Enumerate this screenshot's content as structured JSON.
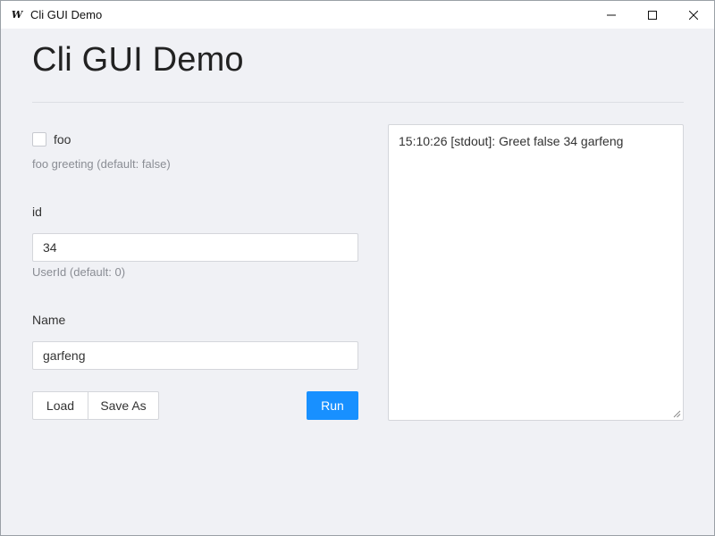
{
  "window": {
    "title": "Cli GUI Demo",
    "app_icon": "W",
    "controls": [
      "minimize-icon",
      "maximize-icon",
      "close-icon"
    ]
  },
  "page": {
    "title": "Cli GUI Demo"
  },
  "form": {
    "foo": {
      "label": "foo",
      "checked": false,
      "help": "foo greeting (default: false)"
    },
    "id": {
      "label": "id",
      "value": "34",
      "help": "UserId (default: 0)"
    },
    "name": {
      "label": "Name",
      "value": "garfeng"
    }
  },
  "buttons": {
    "load": "Load",
    "save_as": "Save As",
    "run": "Run"
  },
  "output": {
    "text": "15:10:26 [stdout]: Greet false 34 garfeng"
  },
  "colors": {
    "accent": "#1890ff",
    "background": "#f0f1f5",
    "help_text": "#8a8d94"
  }
}
